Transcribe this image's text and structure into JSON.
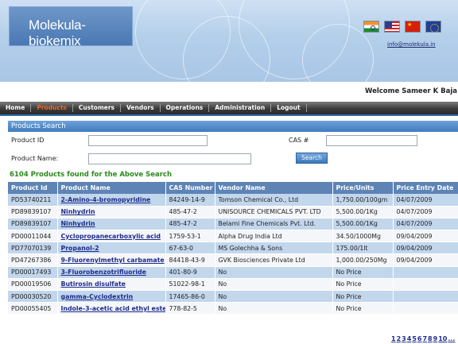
{
  "header": {
    "brand": "Molekula-biokemix",
    "flags": [
      "india-flag-icon",
      "usa-flag-icon",
      "china-flag-icon",
      "eu-flag-icon"
    ],
    "email": "info@molekula.in",
    "welcome": "Welcome Sameer K Baja"
  },
  "nav": {
    "items": [
      "Home",
      "Products",
      "Customers",
      "Vendors",
      "Operations",
      "Administration",
      "Logout"
    ],
    "active": "Products"
  },
  "search": {
    "title": "Products Search",
    "product_id_label": "Product ID",
    "product_name_label": "Product Name:",
    "cas_label": "CAS #",
    "product_id_value": "",
    "product_name_value": "",
    "cas_value": "",
    "button": "Search"
  },
  "results": {
    "summary": "6104 Products found for the Above Search",
    "columns": [
      "Product Id",
      "Product Name",
      "CAS Number",
      "Vendor Name",
      "Price/Units",
      "Price Entry Date"
    ],
    "rows": [
      [
        "PD53740211",
        "2-Amino-4-bromopyridine",
        "84249-14-9",
        "Tomson Chemical Co., Ltd",
        "1,750.00/100gm",
        "04/07/2009"
      ],
      [
        "PD89839107",
        "Ninhydrin",
        "485-47-2",
        "UNISOURCE CHEMICALS PVT. LTD",
        "5,500.00/1Kg",
        "04/07/2009"
      ],
      [
        "PD89839107",
        "Ninhydrin",
        "485-47-2",
        "Belami Fine Chemicals Pvt. Ltd.",
        "5,500.00/1Kg",
        "04/07/2009"
      ],
      [
        "PD00011044",
        "Cyclopropanecarboxylic acid",
        "1759-53-1",
        "Alpha Drug India Ltd",
        "34.50/1000Mg",
        "09/04/2009"
      ],
      [
        "PD77070139",
        "Propanol-2",
        "67-63-0",
        "MS Golechha & Sons",
        "175.00/1lt",
        "09/04/2009"
      ],
      [
        "PD47267386",
        "9-Fluorenylmethyl carbamate",
        "84418-43-9",
        "GVK Biosciences Private Ltd",
        "1,000.00/250Mg",
        "09/04/2009"
      ],
      [
        "PD00017493",
        "3-Fluorobenzotrifluoride",
        "401-80-9",
        "No",
        "No Price",
        ""
      ],
      [
        "PD00019506",
        "Butirosin disulfate",
        "51022-98-1",
        "No",
        "No Price",
        ""
      ],
      [
        "PD00030520",
        "gamma-Cyclodextrin",
        "17465-86-0",
        "No",
        "No Price",
        ""
      ],
      [
        "PD00055405",
        "Indole-3-acetic acid ethyl ester",
        "778-82-5",
        "No",
        "No Price",
        ""
      ]
    ]
  },
  "pager": [
    "1",
    "2",
    "3",
    "4",
    "5",
    "6",
    "7",
    "8",
    "9",
    "10",
    "..."
  ]
}
